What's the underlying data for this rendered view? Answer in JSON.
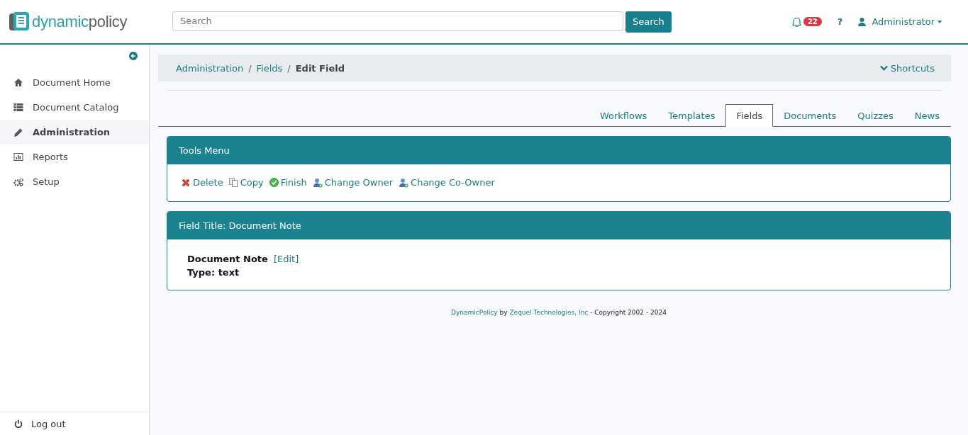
{
  "header": {
    "logo": {
      "part_1": "dynamic",
      "part_2": "policy"
    },
    "search": {
      "placeholder": "Search",
      "button": "Search"
    },
    "notification_count": "22",
    "help": "?",
    "user": "Administrator"
  },
  "sidebar": {
    "items": [
      {
        "label": "Document Home",
        "selected": false
      },
      {
        "label": "Document Catalog",
        "selected": false
      },
      {
        "label": "Administration",
        "selected": true
      },
      {
        "label": "Reports",
        "selected": false
      },
      {
        "label": "Setup",
        "selected": false
      }
    ],
    "logout": "Log out"
  },
  "breadcrumb": [
    "Administration",
    "Fields",
    "Edit Field"
  ],
  "breadcrumb_separators": [
    "/",
    "/"
  ],
  "shortcuts": "Shortcuts",
  "tabs": [
    {
      "label": "Workflows",
      "selected": false
    },
    {
      "label": "Templates",
      "selected": false
    },
    {
      "label": "Fields",
      "selected": true
    },
    {
      "label": "Documents",
      "selected": false
    },
    {
      "label": "Quizzes",
      "selected": false
    },
    {
      "label": "News",
      "selected": false
    }
  ],
  "tools_panel": {
    "title": "Tools Menu",
    "actions": [
      "Delete",
      "Copy",
      "Finish",
      "Change Owner",
      "Change Co-Owner"
    ]
  },
  "field_panel": {
    "title": "Field Title: Document Note",
    "name": "Document Note",
    "edit_link": "[Edit]",
    "type": "Type: text"
  },
  "footer": {
    "product_link": "DynamicPolicy",
    "by": "by",
    "company_link": "Zequel Technologies, Inc",
    "copyright": "- Copyright 2002 - 2024"
  }
}
